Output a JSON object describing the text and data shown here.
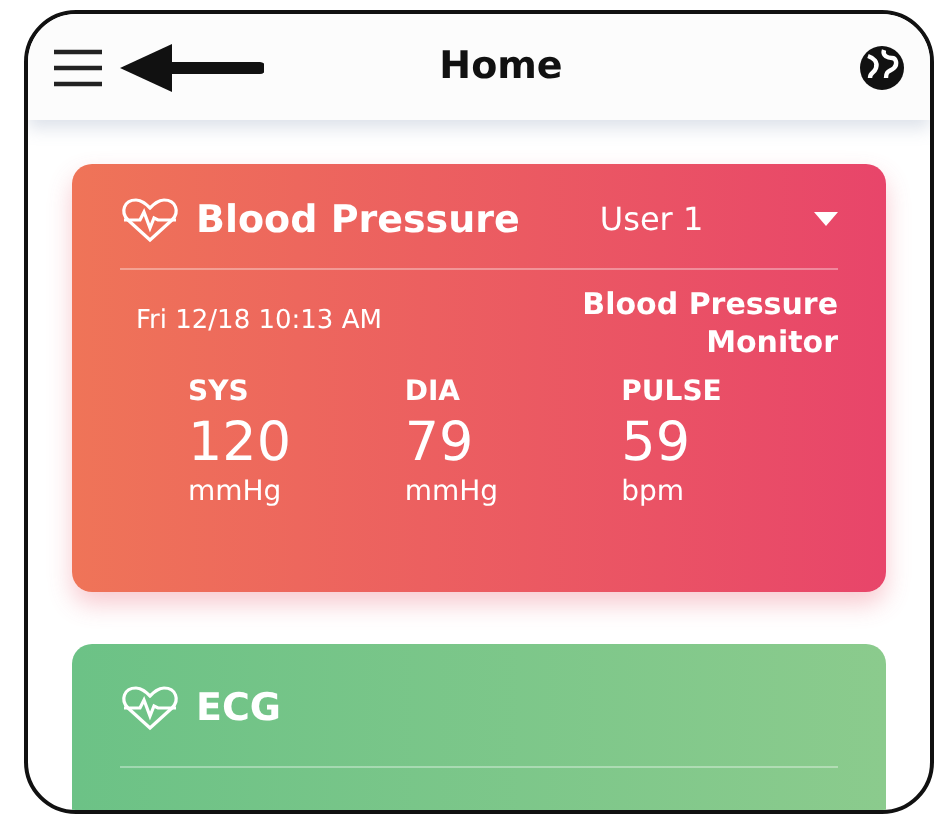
{
  "header": {
    "title": "Home"
  },
  "cards": [
    {
      "kind": "blood_pressure",
      "title": "Blood Pressure",
      "user": "User 1",
      "date": "Fri 12/18 10:13 AM",
      "device": "Blood Pressure Monitor",
      "readings": [
        {
          "label": "SYS",
          "value": "120",
          "unit": "mmHg"
        },
        {
          "label": "DIA",
          "value": "79",
          "unit": "mmHg"
        },
        {
          "label": "PULSE",
          "value": "59",
          "unit": "bpm"
        }
      ]
    },
    {
      "kind": "ecg",
      "title": "ECG"
    }
  ]
}
